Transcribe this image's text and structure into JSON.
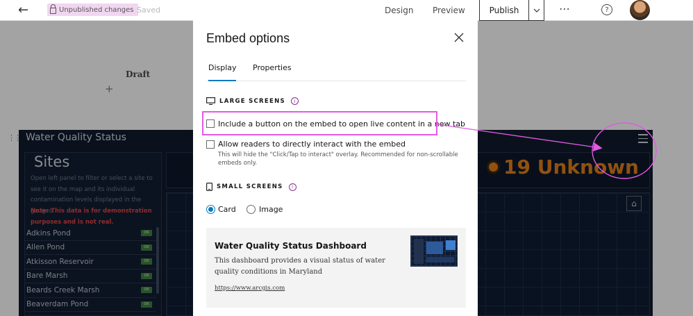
{
  "topbar": {
    "back_icon": "arrow-left-icon",
    "unpublished": "Unpublished changes",
    "saved": "Saved",
    "design": "Design",
    "preview": "Preview",
    "publish": "Publish",
    "more": "⋯",
    "help": "?"
  },
  "canvas": {
    "draft_label": "Draft",
    "embed": {
      "title": "Water Quality Status",
      "sites_title": "Sites",
      "sites_description": "Open left panel to filter or select a site to see it on the map and its individual contamination levels displayed in the gauges.",
      "sites_note": "Note: This data is for demonstration purposes and is not real.",
      "sites": [
        {
          "name": "Adkins Pond",
          "badge": "OK"
        },
        {
          "name": "Allen Pond",
          "badge": "OK"
        },
        {
          "name": "Atkisson Reservoir",
          "badge": "OK"
        },
        {
          "name": "Bare Marsh",
          "badge": "OK"
        },
        {
          "name": "Beards Creek Marsh",
          "badge": "OK"
        },
        {
          "name": "Beaverdam Pond",
          "badge": "OK"
        }
      ],
      "unknown_count": "19 Unknown"
    }
  },
  "modal": {
    "title": "Embed options",
    "tabs": [
      {
        "label": "Display",
        "active": true
      },
      {
        "label": "Properties",
        "active": false
      }
    ],
    "large_screens": {
      "heading": "LARGE SCREENS",
      "options": [
        {
          "label": "Include a button on the embed to open live content in a new tab",
          "checked": false
        },
        {
          "label": "Allow readers to directly interact with the embed",
          "checked": false,
          "description": "This will hide the \"Click/Tap to interact\" overlay. Recommended for non-scrollable embeds only."
        }
      ]
    },
    "small_screens": {
      "heading": "SMALL SCREENS",
      "options": [
        {
          "label": "Card",
          "selected": true
        },
        {
          "label": "Image",
          "selected": false
        }
      ]
    },
    "card_preview": {
      "title": "Water Quality Status Dashboard",
      "description": "This dashboard provides a visual status of water quality conditions in Maryland",
      "link": "https://www.arcgis.com"
    }
  },
  "colors": {
    "accent": "#007ac2",
    "annotation": "#e25ae2",
    "unpublished_bg": "#f1d6f1",
    "warning": "#d6781a"
  }
}
